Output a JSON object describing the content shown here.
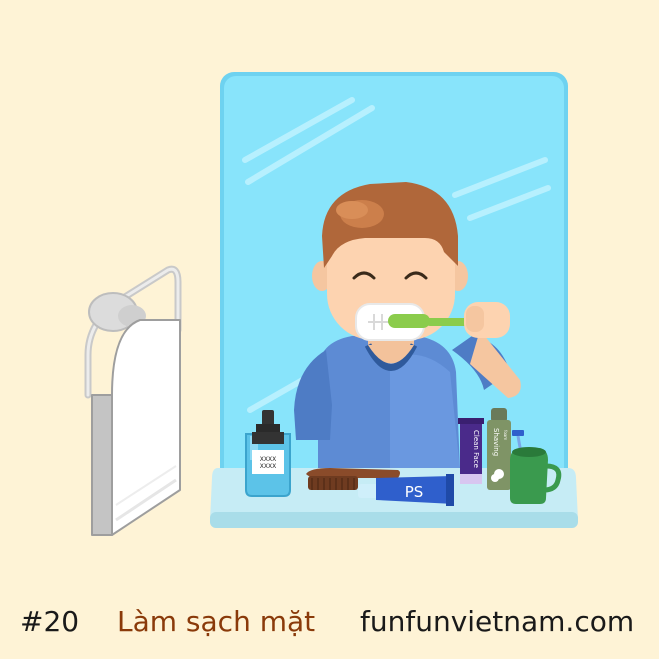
{
  "caption": {
    "number": "#20",
    "title": "Làm sạch mặt",
    "website": "funfunvietnam.com"
  },
  "scene": {
    "mouthwash_label_line1": "XXXX",
    "mouthwash_label_line2": "XXXX",
    "toothpaste_brand": "PS",
    "face_wash_label": "Clean Face",
    "shaving_foam_label": "Shaving",
    "shaving_foam_small_label": "foam"
  },
  "colors": {
    "background": "#fef3d6",
    "mirror": "#88e4fb",
    "mirror_frame": "#6ed2f0",
    "shelf": "#a9dde9",
    "shirt": "#5d8bd4",
    "hair": "#b0673a",
    "skin": "#fdd3b0",
    "toothbrush": "#8bcc4c",
    "caption_title": "#8a3a0a"
  }
}
